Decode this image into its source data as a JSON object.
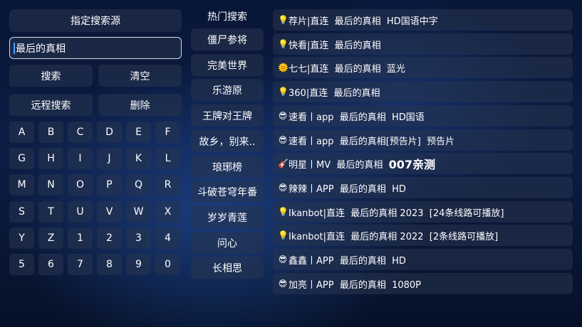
{
  "left": {
    "source_label": "指定搜索源",
    "search_value": "最后的真相",
    "search_label": "搜索",
    "clear_label": "清空",
    "remote_label": "远程搜索",
    "delete_label": "删除"
  },
  "keyboard": {
    "rows": [
      [
        "A",
        "B",
        "C",
        "D",
        "E",
        "F"
      ],
      [
        "G",
        "H",
        "I",
        "J",
        "K",
        "L"
      ],
      [
        "M",
        "N",
        "O",
        "P",
        "Q",
        "R"
      ],
      [
        "S",
        "T",
        "U",
        "V",
        "W",
        "X"
      ],
      [
        "Y",
        "Z",
        "1",
        "2",
        "3",
        "4"
      ],
      [
        "5",
        "6",
        "7",
        "8",
        "9",
        "0"
      ]
    ]
  },
  "hot": {
    "title": "热门搜索",
    "items": [
      "僵尸参将",
      "完美世界",
      "乐游原",
      "王牌对王牌",
      "故乡，别来..",
      "琅琊榜",
      "斗破苍穹年番",
      "岁岁青莲",
      "问心",
      "长相思"
    ]
  },
  "results": [
    {
      "icon": "bulb-icon",
      "glyph": "💡",
      "text": "荐片|直连  最后的真相  HD国语中字"
    },
    {
      "icon": "bulb-icon",
      "glyph": "💡",
      "text": "快看|直连  最后的真相"
    },
    {
      "icon": "sun-icon",
      "glyph": "🌞",
      "text": "七七|直连  最后的真相  蓝光"
    },
    {
      "icon": "bulb-icon",
      "glyph": "💡",
      "text": "360|直连  最后的真相"
    },
    {
      "icon": "sunglasses-face-icon",
      "glyph": "😎",
      "text": "速看丨app  最后的真相  HD国语"
    },
    {
      "icon": "sunglasses-face-icon",
      "glyph": "😎",
      "text": "速看丨app  最后的真相[预告片]  预告片"
    },
    {
      "icon": "guitar-icon",
      "glyph": "🎸",
      "text": "明星丨MV  最后的真相  ",
      "big": "007亲测"
    },
    {
      "icon": "sunglasses-face-icon",
      "glyph": "😎",
      "text": "辣辣丨APP  最后的真相  HD"
    },
    {
      "icon": "bulb-icon",
      "glyph": "💡",
      "text": "Ikanbot|直连  最后的真相 2023  [24条线路可播放]"
    },
    {
      "icon": "bulb-icon",
      "glyph": "💡",
      "text": "Ikanbot|直连  最后的真相 2022  [2条线路可播放]"
    },
    {
      "icon": "sunglasses-face-icon",
      "glyph": "😎",
      "text": "鑫鑫丨APP  最后的真相  HD"
    },
    {
      "icon": "sunglasses-face-icon",
      "glyph": "😎",
      "text": "加亮丨APP  最后的真相  1080P"
    }
  ]
}
